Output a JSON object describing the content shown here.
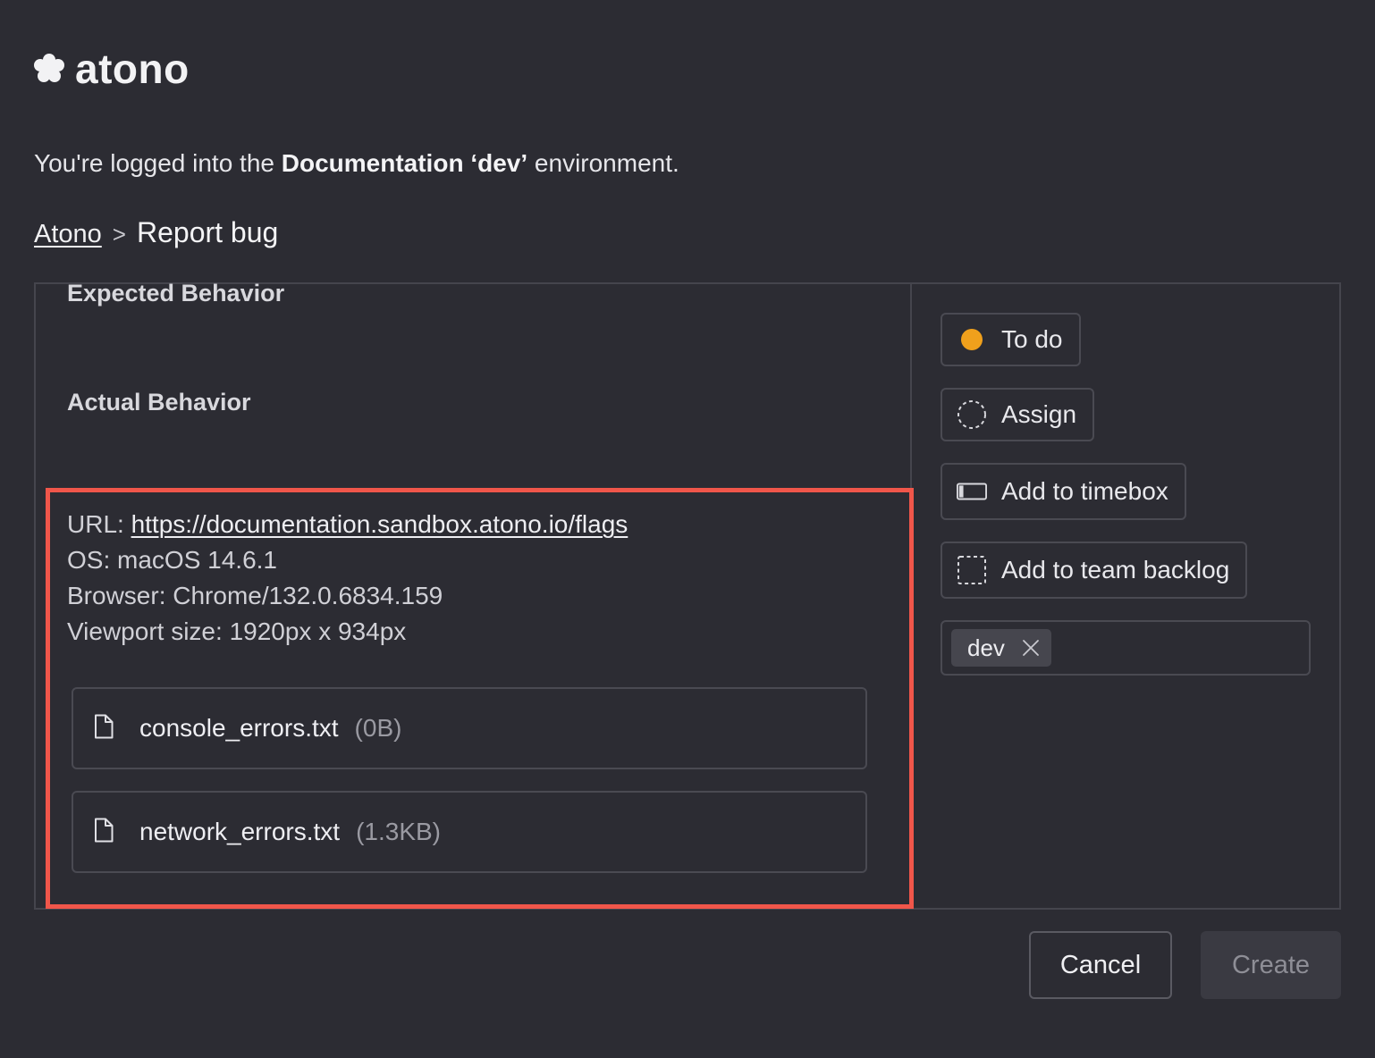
{
  "brand": {
    "name": "atono",
    "logo_icon": "flower-logo-icon"
  },
  "environment_notice": {
    "prefix": "You're logged into the ",
    "environment": "Documentation ‘dev’",
    "suffix": " environment."
  },
  "breadcrumb": {
    "root": "Atono",
    "separator": ">",
    "current": "Report bug"
  },
  "form": {
    "expected_label": "Expected Behavior",
    "actual_label": "Actual Behavior",
    "metadata": {
      "url_label": "URL: ",
      "url": "https://documentation.sandbox.atono.io/flags",
      "os": "OS: macOS 14.6.1",
      "browser": "Browser: Chrome/132.0.6834.159",
      "viewport": "Viewport size: 1920px x 934px"
    },
    "attachments": [
      {
        "name": "console_errors.txt",
        "size": "(0B)",
        "icon": "file-icon"
      },
      {
        "name": "network_errors.txt",
        "size": "(1.3KB)",
        "icon": "file-icon"
      }
    ]
  },
  "sidebar": {
    "status": {
      "label": "To do",
      "color": "#f0a01c"
    },
    "assign": {
      "label": "Assign"
    },
    "timebox": {
      "label": "Add to timebox"
    },
    "backlog": {
      "label": "Add to team backlog"
    },
    "tags": [
      "dev"
    ]
  },
  "footer": {
    "cancel_label": "Cancel",
    "create_label": "Create"
  },
  "colors": {
    "background": "#2c2c33",
    "highlight": "#f0564a",
    "status_todo": "#f0a01c"
  }
}
